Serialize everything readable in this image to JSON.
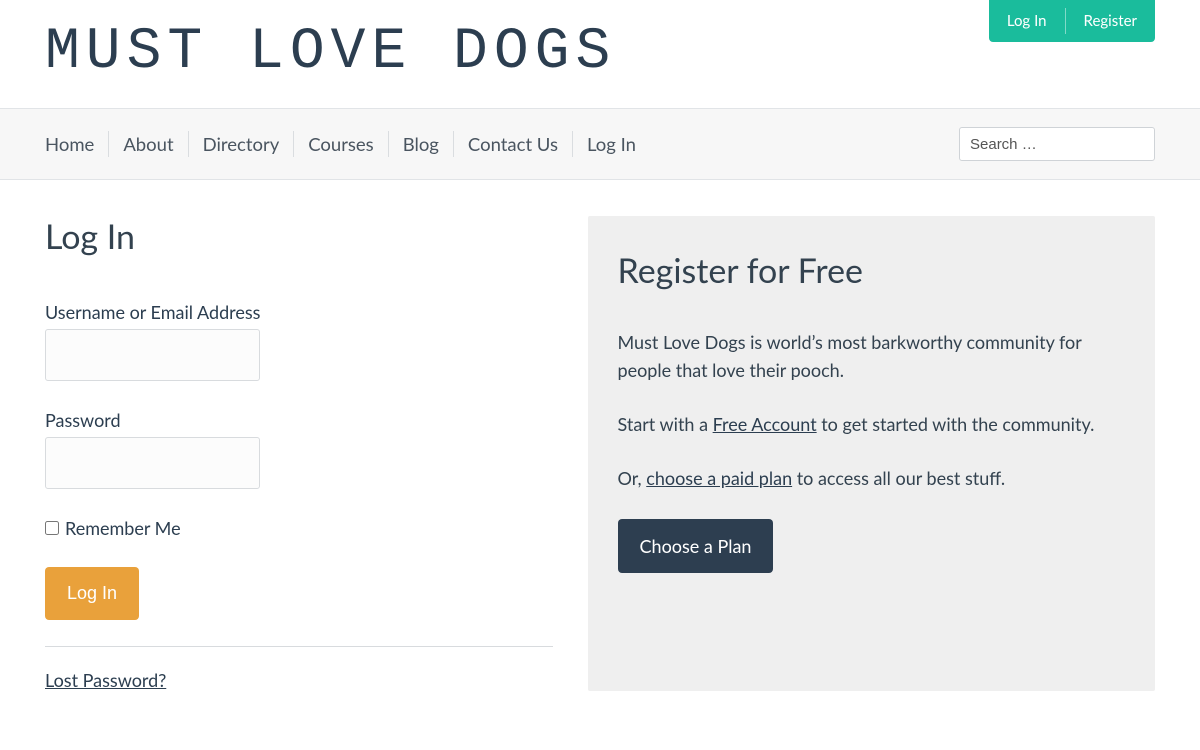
{
  "topbar": {
    "login": "Log In",
    "register": "Register"
  },
  "logo": "MUST LOVE DOGS",
  "nav": {
    "items": [
      "Home",
      "About",
      "Directory",
      "Courses",
      "Blog",
      "Contact Us",
      "Log In"
    ],
    "search_placeholder": "Search …"
  },
  "login": {
    "title": "Log In",
    "username_label": "Username or Email Address",
    "password_label": "Password",
    "remember_label": "Remember Me",
    "submit": "Log In",
    "lost": "Lost Password?"
  },
  "register": {
    "title": "Register for Free",
    "p1": "Must Love Dogs is world’s most barkworthy community for people that love their pooch.",
    "p2_a": "Start with a ",
    "p2_link": "Free Account",
    "p2_b": " to get started with the community.",
    "p3_a": "Or, ",
    "p3_link": "choose a paid plan",
    "p3_b": " to access all our best stuff.",
    "cta": "Choose a Plan"
  }
}
